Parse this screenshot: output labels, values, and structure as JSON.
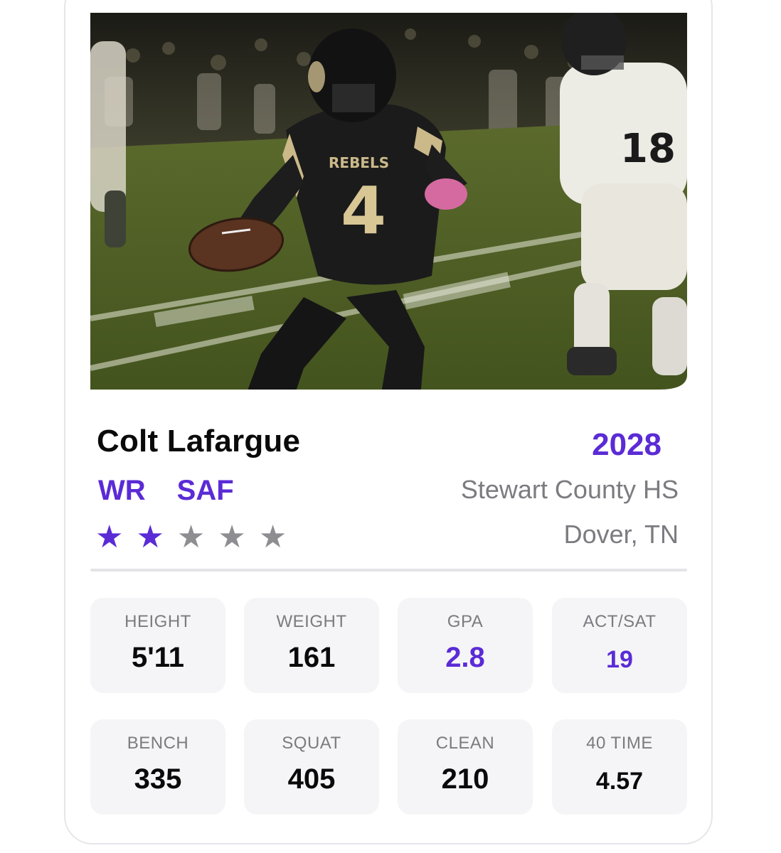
{
  "colors": {
    "accent": "#5b2bd6",
    "muted_text": "#7b7b80",
    "tile_bg": "#f5f5f7"
  },
  "photo": {
    "jersey_text": "REBELS",
    "jersey_number": "4",
    "opponent_number": "18"
  },
  "player": {
    "name": "Colt Lafargue",
    "class_year": "2028",
    "positions": [
      "WR",
      "SAF"
    ],
    "school": "Stewart County HS",
    "location": "Dover, TN",
    "rating": 2,
    "rating_max": 5
  },
  "stats_row1": [
    {
      "label": "HEIGHT",
      "value": "5'11"
    },
    {
      "label": "WEIGHT",
      "value": "161"
    },
    {
      "label": "GPA",
      "value": "2.8"
    },
    {
      "label": "ACT/SAT",
      "value": "19"
    }
  ],
  "stats_row2": [
    {
      "label": "BENCH",
      "value": "335"
    },
    {
      "label": "SQUAT",
      "value": "405"
    },
    {
      "label": "CLEAN",
      "value": "210"
    },
    {
      "label": "40 TIME",
      "value": "4.57"
    }
  ]
}
